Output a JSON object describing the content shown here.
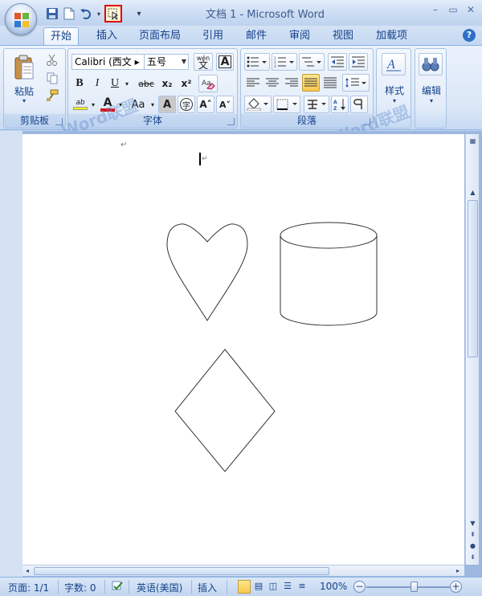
{
  "window": {
    "title": "文档 1 - Microsoft Word",
    "minimize": "–",
    "restore": "▭",
    "close": "✕"
  },
  "tabs": [
    {
      "label": "开始",
      "active": true
    },
    {
      "label": "插入"
    },
    {
      "label": "页面布局"
    },
    {
      "label": "引用"
    },
    {
      "label": "邮件"
    },
    {
      "label": "审阅"
    },
    {
      "label": "视图"
    },
    {
      "label": "加载项"
    }
  ],
  "help": "?",
  "ribbon": {
    "clipboard": {
      "label": "剪贴板",
      "paste": "粘贴"
    },
    "font": {
      "label": "字体",
      "font_name": "Calibri (西文 ▸",
      "font_size": "五号",
      "wen_label": "wén",
      "bold": "B",
      "italic": "I",
      "underline": "U",
      "strike": "abc",
      "subscript": "x₂",
      "superscript": "x²",
      "aa": "Aa",
      "highlight_text": "ab",
      "font_color_letter": "A",
      "char_shade": "A",
      "enclose": "字",
      "grow": "A˄",
      "shrink": "A˅",
      "clear": "A"
    },
    "paragraph": {
      "label": "段落"
    },
    "styles": {
      "label": "样式"
    },
    "editing": {
      "label": "编辑"
    }
  },
  "watermark": "Word联盟",
  "document": {
    "para_mark": "↵"
  },
  "status": {
    "page": "页面: 1/1",
    "words": "字数: 0",
    "language": "英语(美国)",
    "mode": "插入",
    "zoom": "100%",
    "zoom_level": 0.55
  },
  "colors": {
    "accent": "#15428b",
    "highlight_red": "#e00000"
  }
}
